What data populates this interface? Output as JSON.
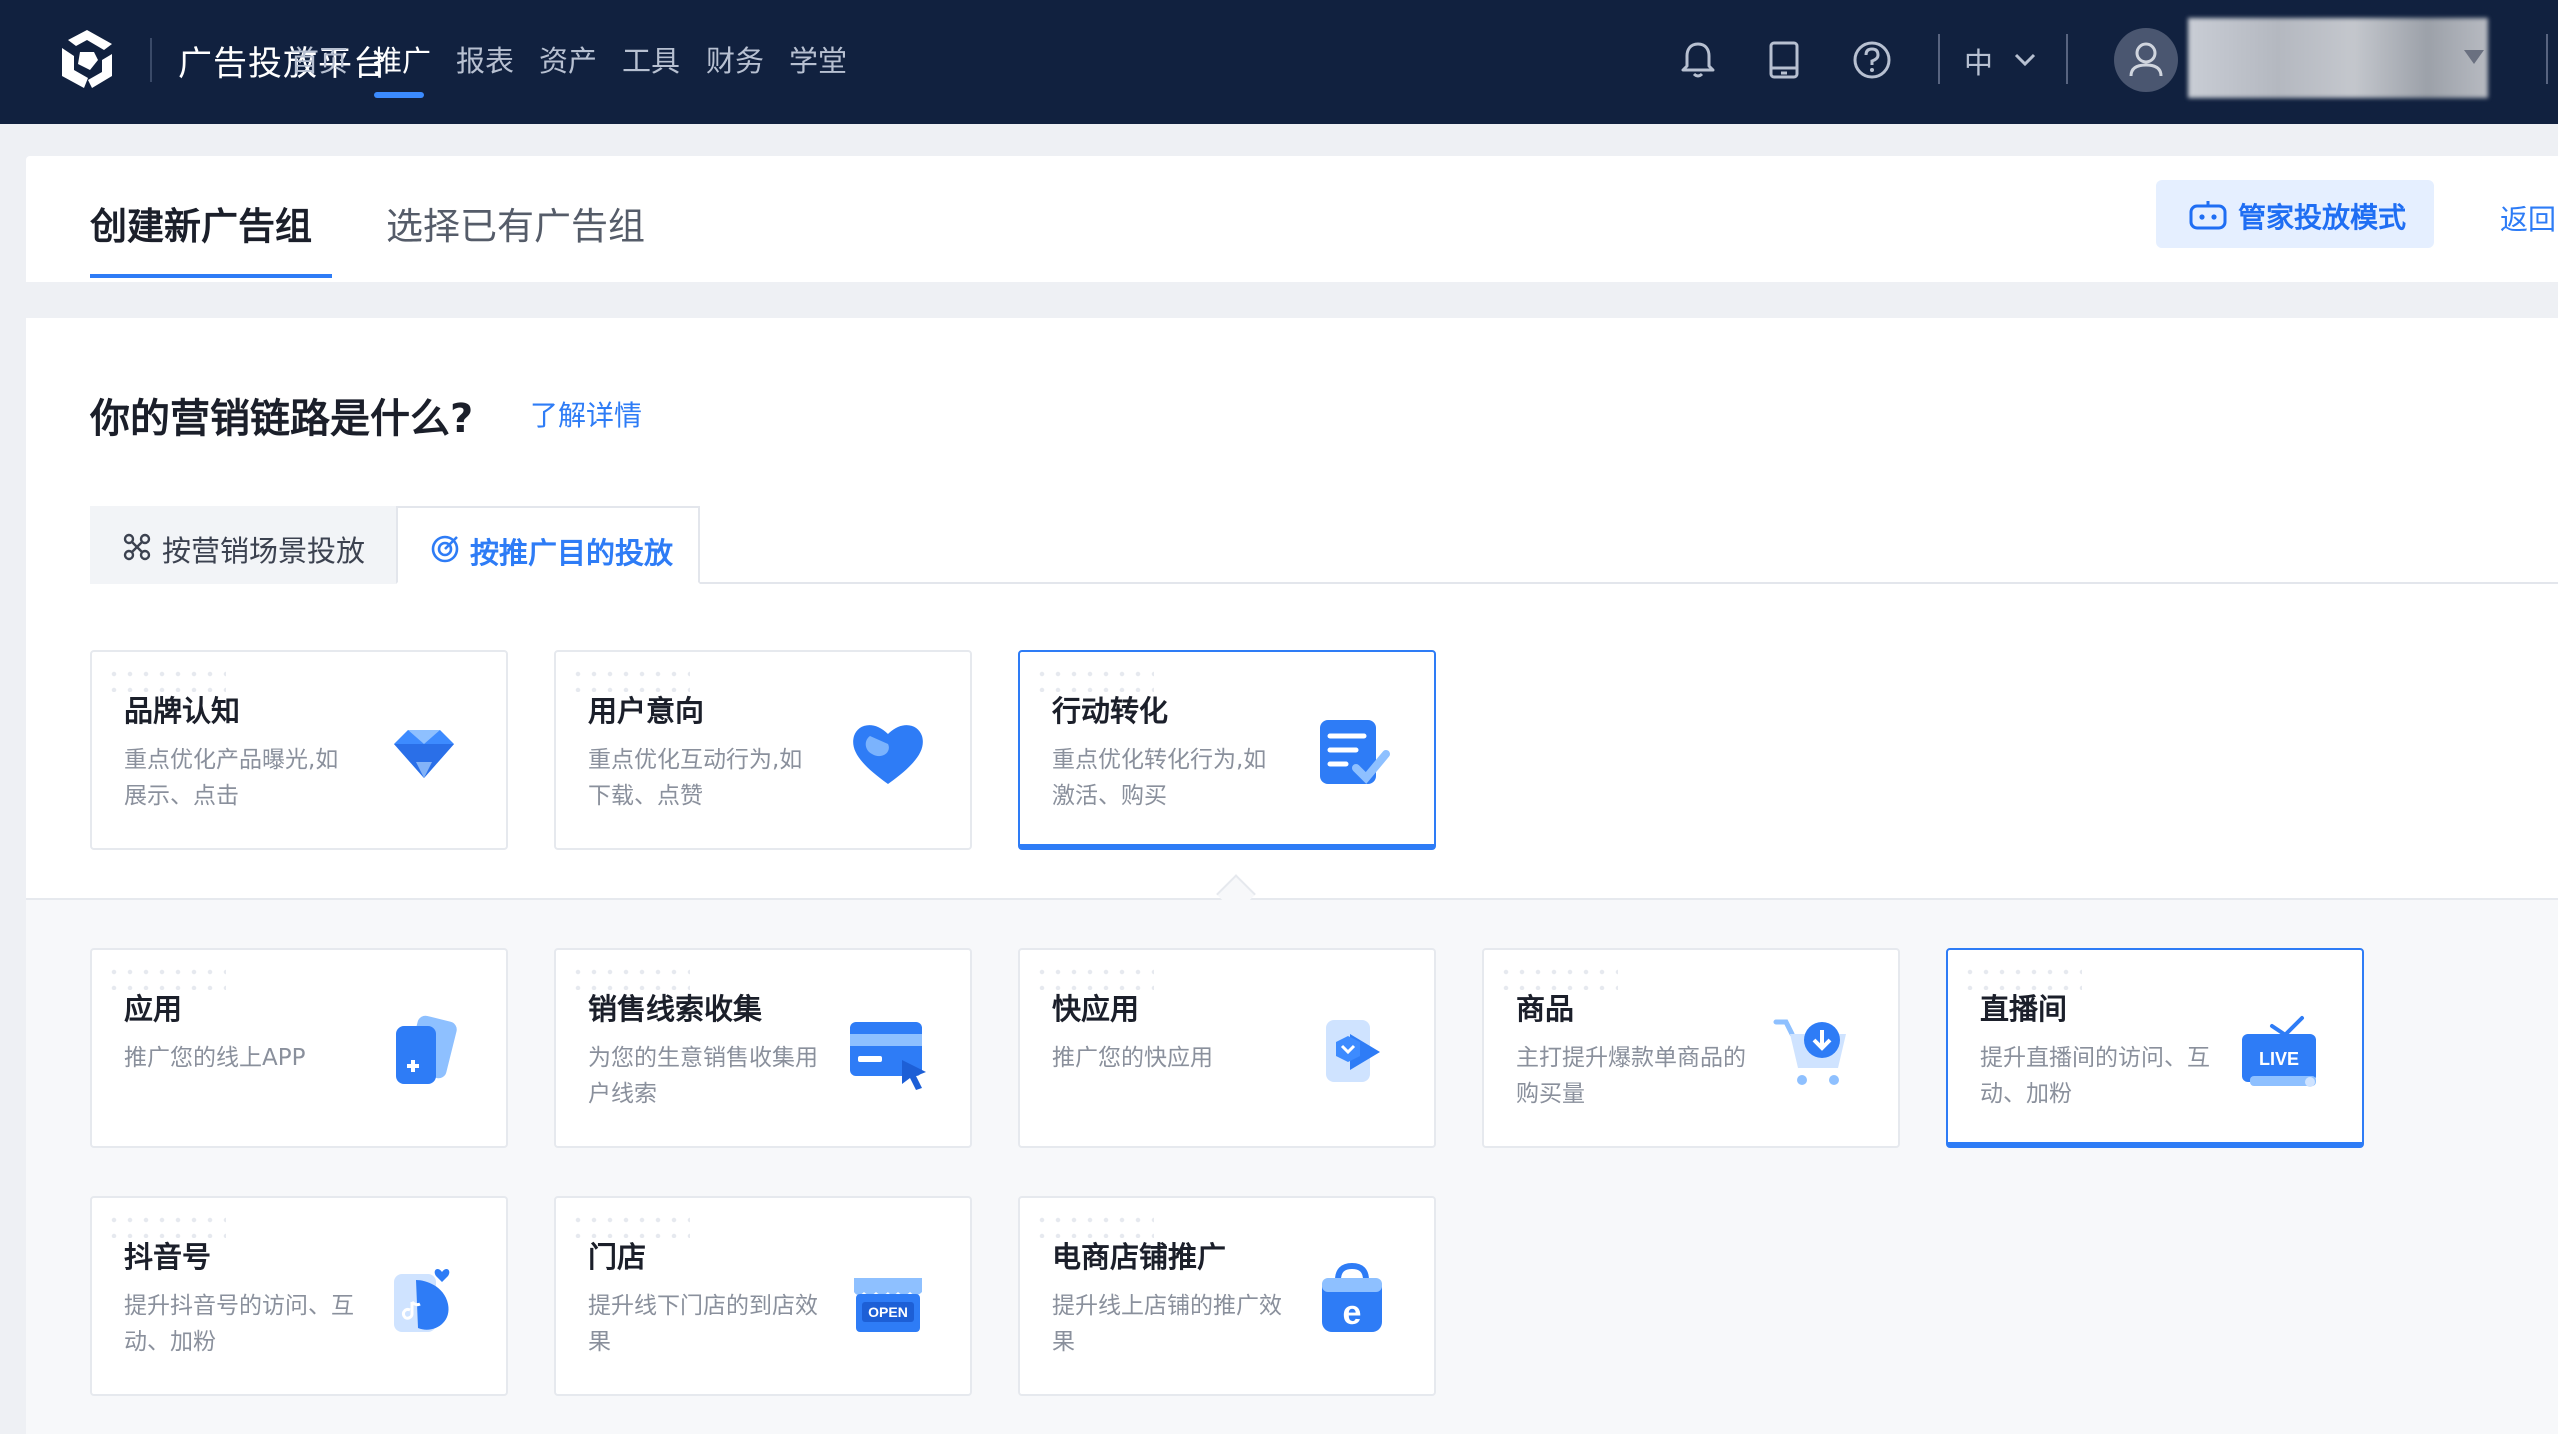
{
  "topbar": {
    "platform_title": "广告投放平台",
    "nav": [
      "首页",
      "推广",
      "报表",
      "资产",
      "工具",
      "财务",
      "学堂"
    ],
    "active_nav": "推广",
    "language": "中"
  },
  "mode_tabs": {
    "create": "创建新广告组",
    "select": "选择已有广告组",
    "butler_label": "管家投放模式",
    "back_label": "返回"
  },
  "main": {
    "question": "你的营销链路是什么?",
    "learn_more": "了解详情",
    "strategy_tabs": {
      "scene": "按营销场景投放",
      "goal": "按推广目的投放"
    }
  },
  "goal_cards": [
    {
      "title": "品牌认知",
      "desc": "重点优化产品曝光,如展示、点击",
      "icon": "diamond-icon",
      "selected": false
    },
    {
      "title": "用户意向",
      "desc": "重点优化互动行为,如下载、点赞",
      "icon": "heart-icon",
      "selected": false
    },
    {
      "title": "行动转化",
      "desc": "重点优化转化行为,如激活、购买",
      "icon": "checklist-icon",
      "selected": true
    }
  ],
  "sub_cards": [
    {
      "title": "应用",
      "desc": "推广您的线上APP",
      "icon": "app-add-icon",
      "selected": false
    },
    {
      "title": "销售线索收集",
      "desc": "为您的生意销售收集用户线索",
      "icon": "card-cursor-icon",
      "selected": false
    },
    {
      "title": "快应用",
      "desc": "推广您的快应用",
      "icon": "quick-app-icon",
      "selected": false
    },
    {
      "title": "商品",
      "desc": "主打提升爆款单商品的购买量",
      "icon": "cart-icon",
      "selected": false
    },
    {
      "title": "直播间",
      "desc": "提升直播间的访问、互动、加粉",
      "icon": "live-tv-icon",
      "selected": true
    },
    {
      "title": "抖音号",
      "desc": "提升抖音号的访问、互动、加粉",
      "icon": "douyin-icon",
      "selected": false
    },
    {
      "title": "门店",
      "desc": "提升线下门店的到店效果",
      "icon": "store-open-icon",
      "selected": false
    },
    {
      "title": "电商店铺推广",
      "desc": "提升线上店铺的推广效果",
      "icon": "shop-bag-icon",
      "selected": false
    }
  ],
  "icon_badges": {
    "live": "LIVE",
    "open": "OPEN",
    "shop": "e"
  },
  "colors": {
    "topbar_bg": "#11213f",
    "accent": "#2e7cf6",
    "card_border": "#e6e9ee"
  }
}
